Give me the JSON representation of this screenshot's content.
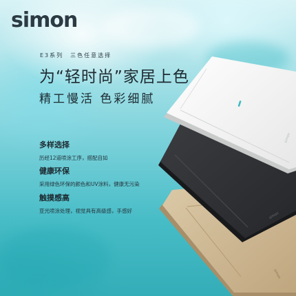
{
  "brand": {
    "logo_text": "simon"
  },
  "header": {
    "series_line": "E3系列　三色任意选择",
    "headline": "为“轻时尚”家居上色",
    "subheadline": "精工慢活 色彩细腻"
  },
  "features": [
    {
      "title": "多样选择",
      "desc": "历经12道喷涂工序，搭配自如"
    },
    {
      "title": "健康环保",
      "desc": "采用绿色环保的颜色和UV涂料，健康无污染"
    },
    {
      "title": "触摸感高",
      "desc": "亚光喷涂处理，视觉具有高级感，手感好"
    }
  ],
  "products": [
    {
      "color_name": "white",
      "hex": "#f4f4f2",
      "brand_mark": "simon"
    },
    {
      "color_name": "black",
      "hex": "#2e3033",
      "brand_mark": "simon"
    },
    {
      "color_name": "champagne-gold",
      "hex": "#cbb592",
      "brand_mark": "simon"
    }
  ],
  "colors": {
    "background_teal": "#46bcc6",
    "indicator_teal": "#3fb7c3",
    "text_dark": "#1d2a31"
  }
}
